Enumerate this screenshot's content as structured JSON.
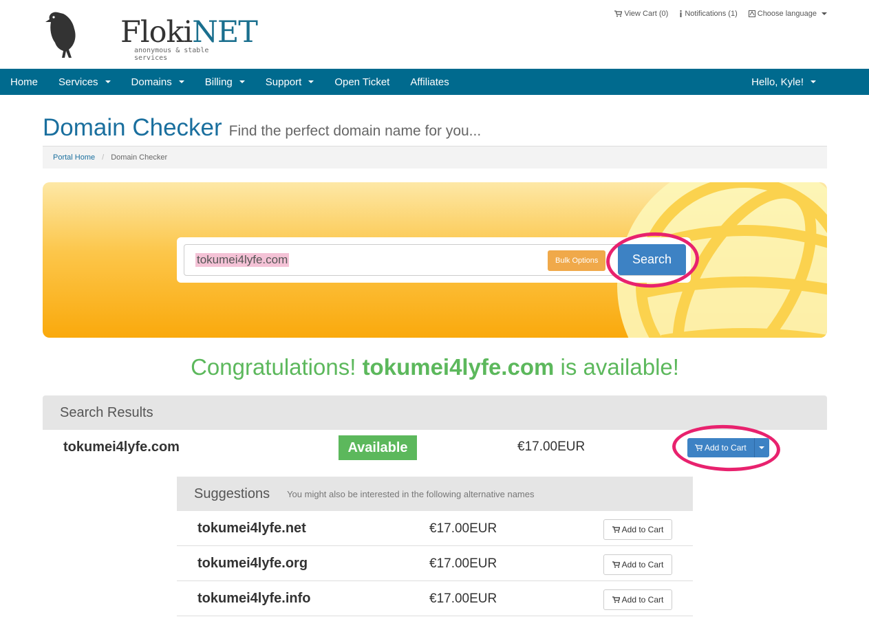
{
  "logo": {
    "brand_a": "Floki",
    "brand_b": "NET",
    "tagline": "anonymous & stable services"
  },
  "toplinks": {
    "cart": "View Cart (0)",
    "notifications": "Notifications (1)",
    "language": "Choose language"
  },
  "nav": {
    "items": [
      {
        "label": "Home",
        "dropdown": false
      },
      {
        "label": "Services",
        "dropdown": true
      },
      {
        "label": "Domains",
        "dropdown": true
      },
      {
        "label": "Billing",
        "dropdown": true
      },
      {
        "label": "Support",
        "dropdown": true
      },
      {
        "label": "Open Ticket",
        "dropdown": false
      },
      {
        "label": "Affiliates",
        "dropdown": false
      }
    ],
    "user": "Hello, Kyle!"
  },
  "page": {
    "title": "Domain Checker",
    "subtitle": "Find the perfect domain name for you..."
  },
  "breadcrumb": {
    "home": "Portal Home",
    "current": "Domain Checker"
  },
  "search": {
    "value": "tokumei4lyfe.com",
    "bulk_label": "Bulk Options",
    "search_label": "Search"
  },
  "result_message": {
    "prefix": "Congratulations!",
    "domain": "tokumei4lyfe.com",
    "suffix": "is available!"
  },
  "results": {
    "heading": "Search Results",
    "row": {
      "domain": "tokumei4lyfe.com",
      "status": "Available",
      "price": "€17.00EUR",
      "button": "Add to Cart"
    }
  },
  "suggestions": {
    "heading": "Suggestions",
    "subheading": "You might also be interested in the following alternative names",
    "rows": [
      {
        "domain": "tokumei4lyfe.net",
        "price": "€17.00EUR",
        "button": "Add to Cart"
      },
      {
        "domain": "tokumei4lyfe.org",
        "price": "€17.00EUR",
        "button": "Add to Cart"
      },
      {
        "domain": "tokumei4lyfe.info",
        "price": "€17.00EUR",
        "button": "Add to Cart"
      }
    ]
  },
  "colors": {
    "nav": "#006a8e",
    "primary": "#3d82c4",
    "success": "#5cb85c",
    "annotation": "#e8226e"
  }
}
